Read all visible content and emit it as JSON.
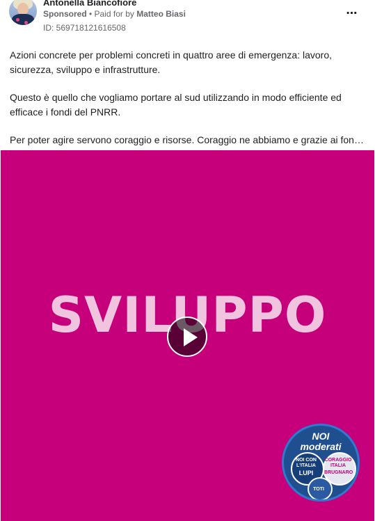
{
  "post": {
    "author": "Antonella Bianco fiore",
    "author_display": "Antonella Biancofiore",
    "sponsored": "Sponsored",
    "separator": " • ",
    "paid_for_prefix": "Paid for by ",
    "payer": "Matteo Biasi",
    "ad_id": "ID: 569718121616508",
    "more_icon": "more-options-icon",
    "paragraphs": [
      "Azioni concrete per problemi concreti in quattro aree di emergenza: lavoro, sicurezza, sviluppo e infrastrutture.",
      "Questo è quello che vogliamo portare al sud utilizzando in modo efficiente ed efficace i fondi del PNRR.",
      "Per poter agire servono coraggio e risorse. Coraggio ne abbiamo e grazie ai fondi…"
    ]
  },
  "media": {
    "background_color": "#c6007a",
    "headline": "SVILUPPO",
    "play_icon": "play-icon",
    "logo": {
      "title_line1": "NOI",
      "title_line2": "moderati",
      "left_top": "NOI CON L'ITALIA",
      "left_bottom": "LUPI",
      "right_top": "CORAGGIO ITALIA",
      "right_bottom": "BRUGNARO",
      "bottom": "TOTI"
    }
  },
  "colors": {
    "text": "#1c1e21",
    "secondary_text": "#65676b",
    "media_background": "#c6007a",
    "headline": "#f0c3df"
  }
}
